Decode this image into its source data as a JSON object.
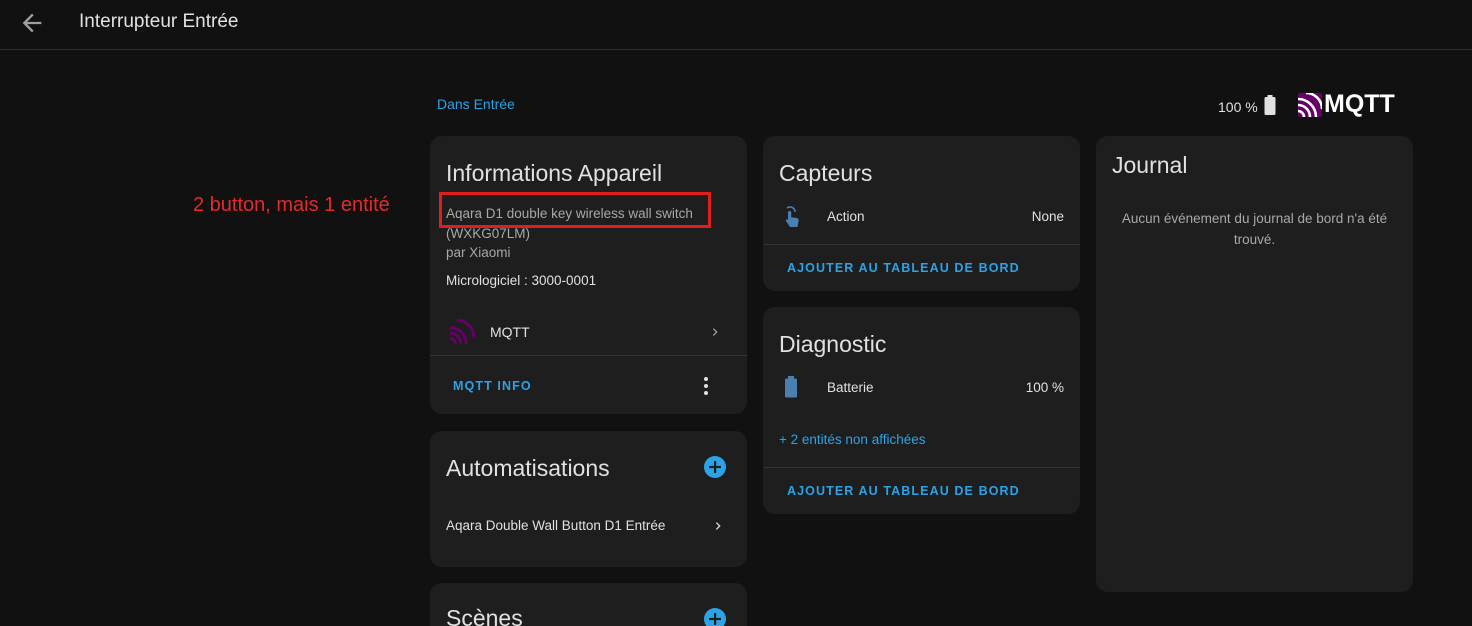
{
  "header": {
    "title": "Interrupteur Entrée"
  },
  "area_link": "Dans Entrée",
  "battery_top": "100 %",
  "brand_logo_text": "MQTT",
  "annotation": "2 button, mais 1 entité",
  "device_info": {
    "title": "Informations Appareil",
    "model_line1": "Aqara D1 double key wireless wall switch",
    "model_line2": "(WXKG07LM)",
    "manufacturer": "par Xiaomi",
    "firmware": "Micrologiciel : 3000-0001",
    "integration_label": "MQTT",
    "action_label": "MQTT INFO"
  },
  "automations": {
    "title": "Automatisations",
    "items": [
      {
        "label": "Aqara Double Wall Button D1 Entrée"
      }
    ]
  },
  "scenes": {
    "title": "Scènes"
  },
  "sensors": {
    "title": "Capteurs",
    "rows": [
      {
        "label": "Action",
        "value": "None",
        "icon": "gesture-tap-icon"
      }
    ],
    "add_label": "AJOUTER AU TABLEAU DE BORD"
  },
  "diagnostic": {
    "title": "Diagnostic",
    "rows": [
      {
        "label": "Batterie",
        "value": "100 %",
        "icon": "battery-icon"
      }
    ],
    "hidden_entities": "+ 2 entités non affichées",
    "add_label": "AJOUTER AU TABLEAU DE BORD"
  },
  "logbook": {
    "title": "Journal",
    "empty_message": "Aucun événement du journal de bord n'a été trouvé."
  },
  "colors": {
    "accent": "#2ba3e6",
    "mqtt_purple": "#660066",
    "annotation_red": "#e32b2b"
  }
}
